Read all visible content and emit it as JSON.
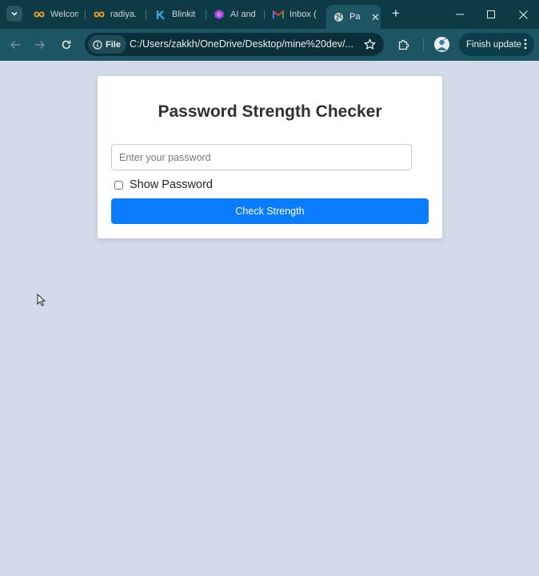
{
  "browser": {
    "tabs": [
      {
        "label": "Welcom",
        "icon": "infinity-icon",
        "active": false
      },
      {
        "label": "radiya.",
        "icon": "infinity-icon",
        "active": false
      },
      {
        "label": "Blinkit",
        "icon": "blinkit-icon",
        "active": false
      },
      {
        "label": "AI and",
        "icon": "hexagon-icon",
        "active": false
      },
      {
        "label": "Inbox (",
        "icon": "gmail-icon",
        "active": false
      },
      {
        "label": "Pa",
        "icon": "globe-icon",
        "active": true
      }
    ],
    "address": {
      "chip_label": "File",
      "url": "C:/Users/zakkh/OneDrive/Desktop/mine%20dev/..."
    },
    "finish_update_label": "Finish update",
    "colors": {
      "tab_strip": "#0e3a45",
      "toolbar": "#1e5563",
      "omnibox": "#0b2f38"
    }
  },
  "page": {
    "background": "#d3dbe9",
    "title": "Password Strength Checker",
    "password_placeholder": "Enter your password",
    "password_value": "",
    "show_password_label": "Show Password",
    "show_password_checked": false,
    "check_button_label": "Check Strength",
    "button_color": "#0a7cff"
  }
}
